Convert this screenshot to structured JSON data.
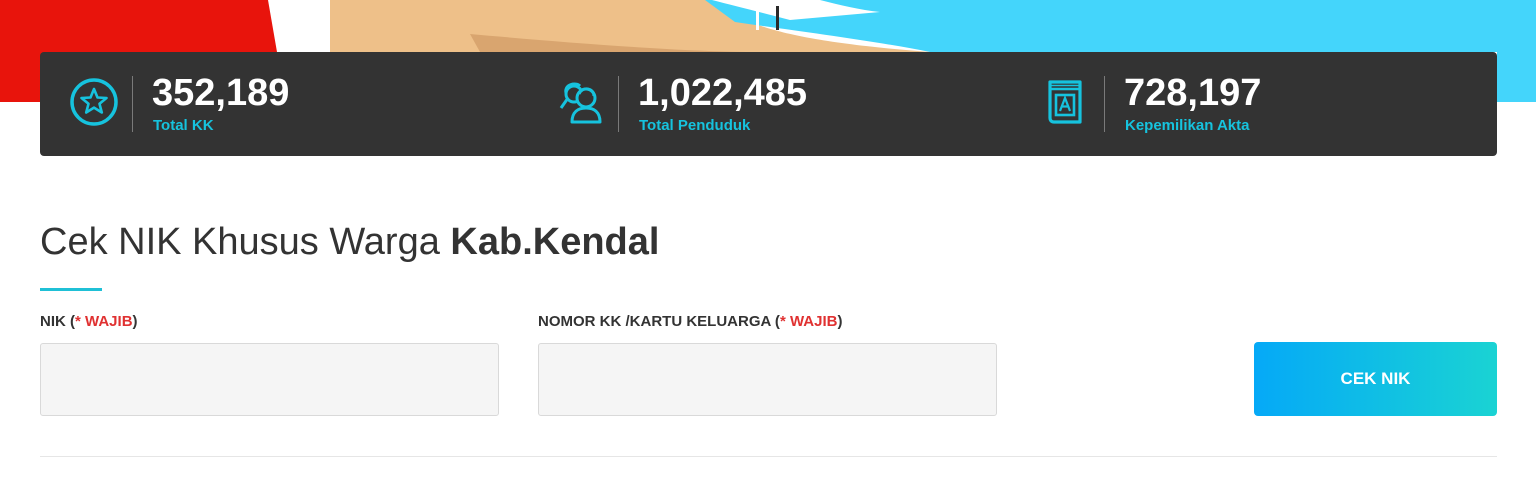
{
  "colors": {
    "accent": "#16c3de",
    "required": "#e03131",
    "stats_background": "#333333",
    "button_start": "#05a9f7",
    "button_end": "#1ad3d3",
    "hero_red": "#e8140c",
    "hero_blue": "#44d5fb",
    "hero_skin": "#eec089"
  },
  "stats": [
    {
      "icon": "star-badge-icon",
      "value": "352,189",
      "label": "Total KK"
    },
    {
      "icon": "people-icon",
      "value": "1,022,485",
      "label": "Total Penduduk"
    },
    {
      "icon": "book-icon",
      "value": "728,197",
      "label": "Kepemilikan Akta"
    }
  ],
  "title": {
    "prefix": "Cek NIK Khusus Warga ",
    "emphasis": "Kab.Kendal"
  },
  "form": {
    "nik": {
      "label": "NIK",
      "open_paren": " (",
      "required": "* WAJIB",
      "close_paren": ")",
      "value": "",
      "placeholder": ""
    },
    "kk": {
      "label": "NOMOR KK /KARTU KELUARGA",
      "open_paren": " (",
      "required": "* WAJIB",
      "close_paren": ")",
      "value": "",
      "placeholder": ""
    },
    "submit_label": "CEK NIK"
  }
}
